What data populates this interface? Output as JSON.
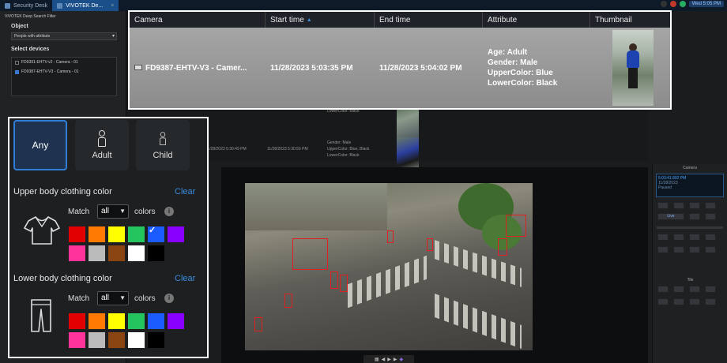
{
  "tabs": [
    {
      "label": "Security Desk"
    },
    {
      "label": "VIVOTEK De..."
    }
  ],
  "system_time": "Wed 5:05 PM",
  "sidebar": {
    "title": "VIVOTEK Deep Search Filter",
    "object_heading": "Object",
    "object_value": "People with attribute",
    "devices_heading": "Select devices",
    "devices": [
      {
        "label": "FD9391-EHTV-v2 - Camera - 01",
        "checked": false
      },
      {
        "label": "FD9387-EHTV-V3 - Camera - 01",
        "checked": true
      }
    ]
  },
  "results_background": {
    "rows": [
      {
        "attr_lines": [
          "LowerColor: Black"
        ]
      },
      {
        "start": "11/28/2023 5:30:49 PM",
        "end": "11/28/2023 5:30:56 PM",
        "attr_lines": [
          "Gender: Male",
          "UpperColor: Blue, Black",
          "LowerColor: Black"
        ]
      }
    ]
  },
  "featured": {
    "columns": [
      "Camera",
      "Start time",
      "End time",
      "Attribute",
      "Thumbnail"
    ],
    "row": {
      "camera": "FD9387-EHTV-V3 - Camer...",
      "start": "11/28/2023 5:03:35 PM",
      "end": "11/28/2023 5:04:02 PM",
      "attributes": [
        "Age: Adult",
        "Gender: Male",
        "UpperColor: Blue",
        "LowerColor: Black"
      ]
    }
  },
  "right_panel": {
    "title": "Camera",
    "clock_time": "5:03:41.892 PM",
    "clock_date": "11/28/2023",
    "clock_status": "Paused",
    "live_label": "Live",
    "tile_label": "Tile"
  },
  "filter": {
    "age_options": [
      {
        "label": "Any",
        "selected": true
      },
      {
        "label": "Adult",
        "selected": false
      },
      {
        "label": "Child",
        "selected": false
      }
    ],
    "upper": {
      "title": "Upper body clothing color",
      "clear": "Clear",
      "match_label": "Match",
      "match_value": "all",
      "colors_label": "colors"
    },
    "lower": {
      "title": "Lower body clothing color",
      "clear": "Clear",
      "match_label": "Match",
      "match_value": "all",
      "colors_label": "colors"
    },
    "palette": [
      "#e30000",
      "#ff7a00",
      "#ffff00",
      "#22c55e",
      "#1a5cff",
      "#8800ff",
      "#ff3399",
      "#bbbbbb",
      "#8b4513",
      "#ffffff",
      "#000000"
    ],
    "upper_selected": "#1a5cff",
    "lower_selected": null
  }
}
